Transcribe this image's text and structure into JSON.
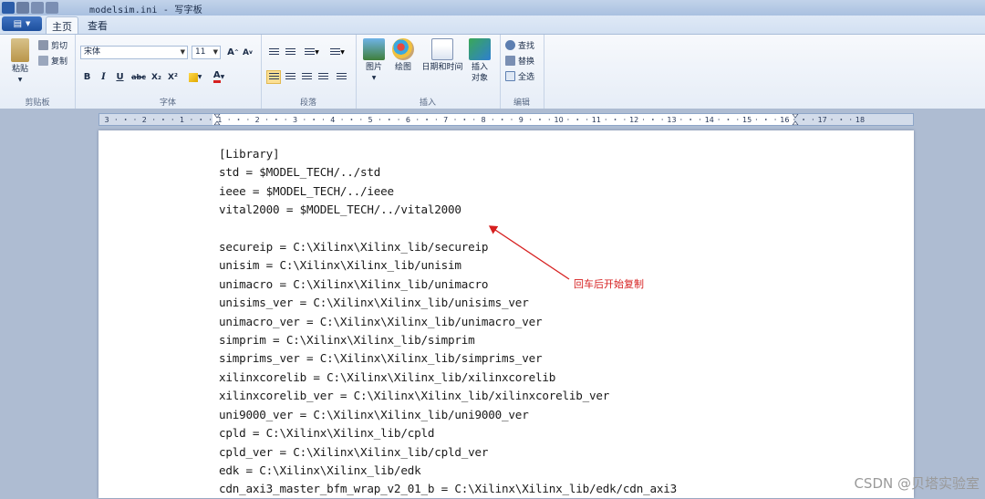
{
  "window": {
    "title": "modelsim.ini - 写字板"
  },
  "ribbon": {
    "tabs": [
      {
        "label": "主页",
        "active": true
      },
      {
        "label": "查看",
        "active": false
      }
    ],
    "clipboard": {
      "paste": "粘贴",
      "cut": "剪切",
      "copy": "复制",
      "group_label": "剪贴板"
    },
    "font": {
      "family": "宋体",
      "size": "11",
      "bold": "B",
      "italic": "I",
      "underline": "U",
      "strike": "abc",
      "subscript": "X₂",
      "superscript": "X²",
      "group_label": "字体"
    },
    "paragraph": {
      "group_label": "段落"
    },
    "insert": {
      "picture": "图片",
      "paint": "绘图",
      "datetime": "日期和时间",
      "object_line1": "插入",
      "object_line2": "对象",
      "group_label": "插入"
    },
    "editing": {
      "find": "查找",
      "replace": "替换",
      "select_all": "全选",
      "group_label": "编辑"
    }
  },
  "ruler": {
    "labels": [
      "3",
      "2",
      "1",
      "1",
      "2",
      "3",
      "4",
      "5",
      "6",
      "7",
      "8",
      "9",
      "10",
      "11",
      "12",
      "13",
      "14",
      "15",
      "16",
      "17",
      "18"
    ]
  },
  "document": {
    "lines": [
      "[Library]",
      "std = $MODEL_TECH/../std",
      "ieee = $MODEL_TECH/../ieee",
      "vital2000 = $MODEL_TECH/../vital2000",
      "",
      "secureip = C:\\Xilinx\\Xilinx_lib/secureip",
      "unisim = C:\\Xilinx\\Xilinx_lib/unisim",
      "unimacro = C:\\Xilinx\\Xilinx_lib/unimacro",
      "unisims_ver = C:\\Xilinx\\Xilinx_lib/unisims_ver",
      "unimacro_ver = C:\\Xilinx\\Xilinx_lib/unimacro_ver",
      "simprim = C:\\Xilinx\\Xilinx_lib/simprim",
      "simprims_ver = C:\\Xilinx\\Xilinx_lib/simprims_ver",
      "xilinxcorelib = C:\\Xilinx\\Xilinx_lib/xilinxcorelib",
      "xilinxcorelib_ver = C:\\Xilinx\\Xilinx_lib/xilinxcorelib_ver",
      "uni9000_ver = C:\\Xilinx\\Xilinx_lib/uni9000_ver",
      "cpld = C:\\Xilinx\\Xilinx_lib/cpld",
      "cpld_ver = C:\\Xilinx\\Xilinx_lib/cpld_ver",
      "edk = C:\\Xilinx\\Xilinx_lib/edk",
      "cdn_axi3_master_bfm_wrap_v2_01_b = C:\\Xilinx\\Xilinx_lib/edk/cdn_axi3"
    ]
  },
  "annotation": {
    "text": "回车后开始复制",
    "color": "#d62020"
  },
  "watermark": {
    "text": "CSDN @贝塔实验室"
  }
}
